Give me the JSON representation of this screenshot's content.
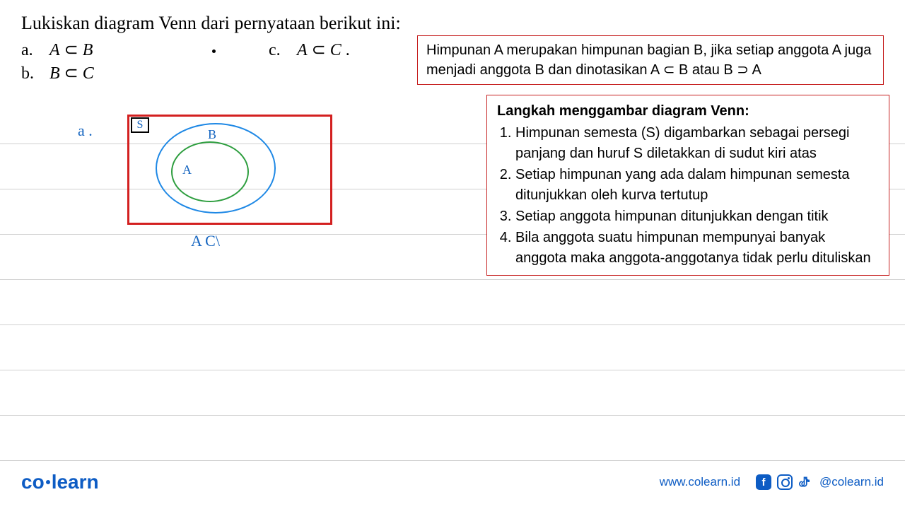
{
  "title": "Lukiskan diagram Venn dari pernyataan berikut ini:",
  "problems": {
    "a": {
      "label": "a.",
      "expr_left": "A",
      "rel": "⊂",
      "expr_right": "B"
    },
    "b": {
      "label": "b.",
      "expr_left": "B",
      "rel": "⊂",
      "expr_right": "C"
    },
    "c": {
      "label": "c.",
      "expr_left": "A",
      "rel": "⊂",
      "expr_right": "C",
      "trail": "."
    }
  },
  "definition_box": "Himpunan A merupakan himpunan bagian B, jika setiap anggota A juga menjadi anggota B dan dinotasikan A ⊂ B atau B ⊃ A",
  "steps_box": {
    "title": "Langkah menggambar diagram Venn:",
    "items": [
      "Himpunan semesta (S) digambarkan sebagai persegi panjang dan huruf S diletakkan di sudut kiri atas",
      "Setiap himpunan yang ada dalam himpunan semesta ditunjukkan oleh kurva tertutup",
      "Setiap anggota himpunan ditunjukkan dengan titik",
      "Bila anggota suatu himpunan mempunyai banyak anggota maka anggota-anggotanya tidak perlu dituliskan"
    ]
  },
  "diagram": {
    "item_label": "a .",
    "s_label": "S",
    "outer_label": "B",
    "inner_label": "A",
    "caption": "A C\\"
  },
  "footer": {
    "brand_left": "co",
    "brand_right": "learn",
    "url": "www.colearn.id",
    "handle": "@colearn.id"
  }
}
